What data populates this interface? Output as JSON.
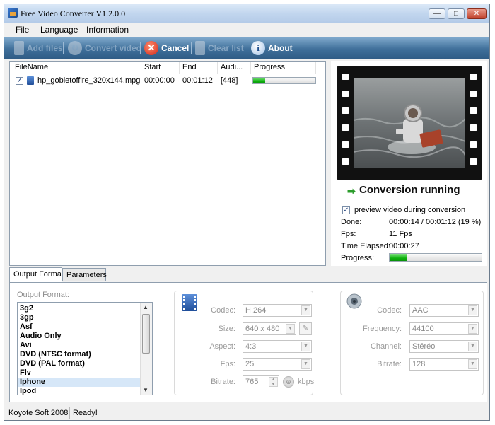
{
  "window": {
    "title": "Free Video Converter V1.2.0.0"
  },
  "menu": [
    "File",
    "Language",
    "Information"
  ],
  "toolbar": {
    "add_files": "Add files",
    "convert_video": "Convert video",
    "cancel": "Cancel",
    "clear_list": "Clear list",
    "about": "About"
  },
  "file_list": {
    "columns": [
      "FileName",
      "Start",
      "End",
      "Audi...",
      "Progress"
    ],
    "rows": [
      {
        "checked": true,
        "filename": "hp_gobletoffire_320x144.mpg",
        "start": "00:00:00",
        "end": "00:01:12",
        "audio": "[448]",
        "progress": 0.19
      }
    ]
  },
  "preview": {
    "status": "Conversion running",
    "preview_checkbox_label": "preview video during conversion",
    "preview_checked": true,
    "done_label": "Done:",
    "done_value": "00:00:14 / 00:01:12  (19 %)",
    "fps_label": "Fps:",
    "fps_value": "11 Fps",
    "elapsed_label": "Time Elapsed:",
    "elapsed_value": "00:00:27",
    "progress_label": "Progress:",
    "progress": 0.19
  },
  "tabs": [
    "Output Format",
    "Parameters"
  ],
  "output": {
    "label": "Output Format:",
    "formats": [
      "3g2",
      "3gp",
      "Asf",
      "Audio Only",
      "Avi",
      "DVD (NTSC format)",
      "DVD (PAL format)",
      "Flv",
      "Iphone",
      "Ipod"
    ],
    "selected": "Iphone"
  },
  "video": {
    "codec_label": "Codec:",
    "codec": "H.264",
    "size_label": "Size:",
    "size": "640 x 480",
    "aspect_label": "Aspect:",
    "aspect": "4:3",
    "fps_label": "Fps:",
    "fps": "25",
    "bitrate_label": "Bitrate:",
    "bitrate": "765",
    "bitrate_unit": "kbps"
  },
  "audio": {
    "codec_label": "Codec:",
    "codec": "AAC",
    "frequency_label": "Frequency:",
    "frequency": "44100",
    "channel_label": "Channel:",
    "channel": "Stéréo",
    "bitrate_label": "Bitrate:",
    "bitrate": "128"
  },
  "statusbar": {
    "company": "Koyote Soft 2008",
    "status": "Ready!"
  },
  "colors": {
    "toolbar": "#3f6f9a",
    "progress_green": "#0fb30f",
    "status_green": "#2b9c2b"
  }
}
